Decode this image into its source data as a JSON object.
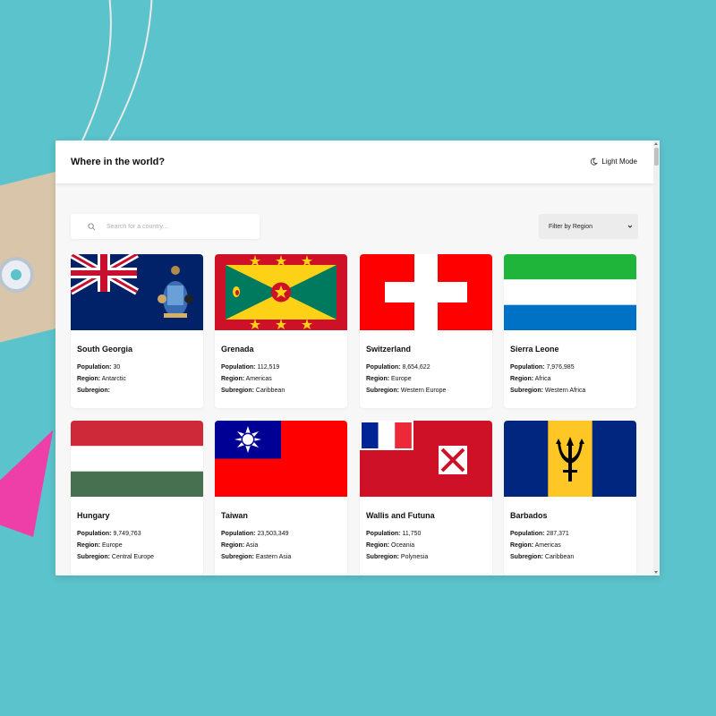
{
  "header": {
    "title": "Where in the world?",
    "mode_label": "Light Mode",
    "mode_icon": "moon-icon"
  },
  "search": {
    "placeholder": "Search for a country...",
    "value": "",
    "icon": "search-icon"
  },
  "filter": {
    "label": "Filter by Region",
    "icon": "chevron-down-icon"
  },
  "labels": {
    "population": "Population:",
    "region": "Region:",
    "subregion": "Subregion:"
  },
  "countries": [
    {
      "name": "South Georgia",
      "population": "30",
      "region": "Antarctic",
      "subregion": ""
    },
    {
      "name": "Grenada",
      "population": "112,519",
      "region": "Americas",
      "subregion": "Caribbean"
    },
    {
      "name": "Switzerland",
      "population": "8,654,622",
      "region": "Europe",
      "subregion": "Western Europe"
    },
    {
      "name": "Sierra Leone",
      "population": "7,976,985",
      "region": "Africa",
      "subregion": "Western Africa"
    },
    {
      "name": "Hungary",
      "population": "9,749,763",
      "region": "Europe",
      "subregion": "Central Europe"
    },
    {
      "name": "Taiwan",
      "population": "23,503,349",
      "region": "Asia",
      "subregion": "Eastern Asia"
    },
    {
      "name": "Wallis and Futuna",
      "population": "11,750",
      "region": "Oceania",
      "subregion": "Polynesia"
    },
    {
      "name": "Barbados",
      "population": "287,371",
      "region": "Americas",
      "subregion": "Caribbean"
    }
  ]
}
